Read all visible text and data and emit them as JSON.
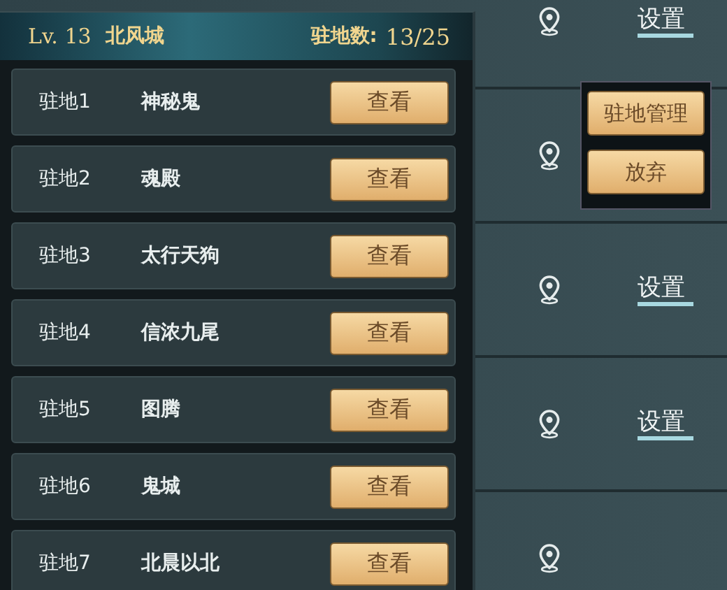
{
  "background_rows": [
    {
      "link": "设置"
    },
    {},
    {
      "link": "设置"
    },
    {
      "link": "设置"
    },
    {}
  ],
  "panel": {
    "level": "Lv. 13",
    "city": "北风城",
    "count_label": "驻地数:",
    "count": "13/25",
    "items": [
      {
        "slot": "驻地1",
        "name": "神秘鬼",
        "button": "查看"
      },
      {
        "slot": "驻地2",
        "name": "魂殿",
        "button": "查看"
      },
      {
        "slot": "驻地3",
        "name": "太行天狗",
        "button": "查看"
      },
      {
        "slot": "驻地4",
        "name": "信浓九尾",
        "button": "查看"
      },
      {
        "slot": "驻地5",
        "name": "图腾",
        "button": "查看"
      },
      {
        "slot": "驻地6",
        "name": "鬼城",
        "button": "查看"
      },
      {
        "slot": "驻地7",
        "name": "北晨以北",
        "button": "查看"
      }
    ]
  },
  "menu": {
    "buttons": [
      "驻地管理",
      "放弃"
    ]
  }
}
